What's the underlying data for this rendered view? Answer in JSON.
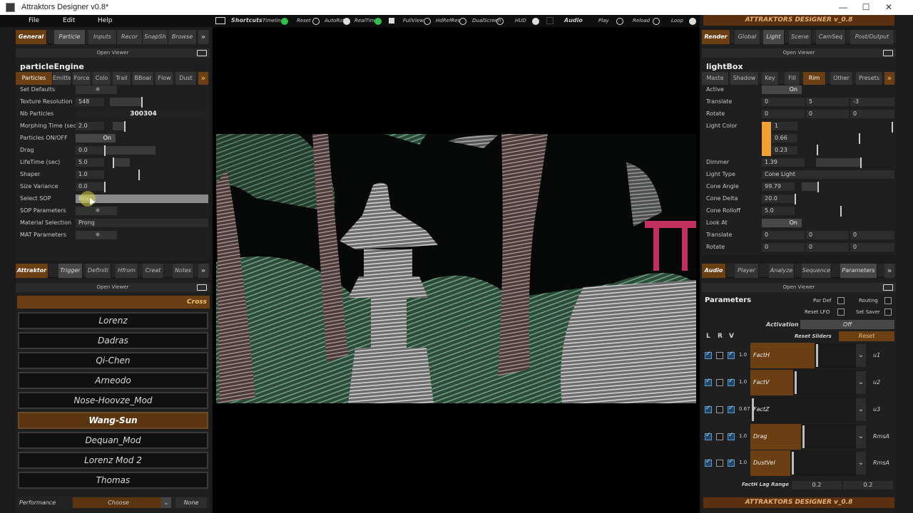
{
  "window": {
    "title": "Attraktors Designer v0.8*"
  },
  "menu": {
    "file": "File",
    "edit": "Edit",
    "help": "Help"
  },
  "toolbar": {
    "shortcuts": "Shortcuts",
    "timeline": "Timeline",
    "reset": "Reset",
    "autorot": "AutoRot",
    "realtime": "RealTime",
    "fullview": "FullView",
    "hdrefres": "HdRefRes",
    "dualscreen": "DualScreen",
    "hud": "HUD",
    "audio": "Audio",
    "play": "Play",
    "reload": "Reload",
    "loop": "Loop"
  },
  "left_top": {
    "tabs": [
      "General",
      "Particle",
      "Inputs",
      "Recor",
      "SnapSh",
      "Browse"
    ],
    "open_viewer": "Open Viewer",
    "title": "particleEngine",
    "subtabs": [
      "Particles",
      "Emitte",
      "Force",
      "Colo",
      "Trail",
      "BBoar",
      "Flow",
      "Dust"
    ],
    "params": [
      {
        "label": "Set Defaults",
        "value": ""
      },
      {
        "label": "Texture Resolution",
        "value": "548"
      },
      {
        "label": "Nb Particles",
        "value": "300304"
      },
      {
        "label": "Morphing Time (sec)",
        "value": "2.0"
      },
      {
        "label": "Particles ON/OFF",
        "value": "On"
      },
      {
        "label": "Drag",
        "value": "0.0"
      },
      {
        "label": "LifeTime (sec)",
        "value": "5.0"
      },
      {
        "label": "Shaper",
        "value": "1.0"
      },
      {
        "label": "Size Variance",
        "value": "0.0"
      },
      {
        "label": "Select SOP",
        "value": "Box"
      },
      {
        "label": "SOP Parameters",
        "value": ""
      },
      {
        "label": "Material Selection",
        "value": "Prong"
      },
      {
        "label": "MAT Parameters",
        "value": ""
      }
    ]
  },
  "left_bottom": {
    "tabs": [
      "Attraktor",
      "Trigger",
      "Definiti",
      "Hfrom",
      "Creat",
      "Notes"
    ],
    "open_viewer": "Open Viewer",
    "header": "Cross",
    "attractors": [
      "Lorenz",
      "Dadras",
      "Qi-Chen",
      "Arneodo",
      "Nose-Hoovze_Mod",
      "Wang-Sun",
      "Dequan_Mod",
      "Lorenz Mod 2",
      "Thomas"
    ],
    "selected": "Wang-Sun",
    "performance_label": "Performance",
    "choose": "Choose",
    "none": "None"
  },
  "right_top": {
    "header": "ATTRAKTORS DESIGNER v_0.8",
    "tabs": [
      "Render",
      "Global",
      "Light",
      "Scene",
      "CamSeq",
      "Post/Output"
    ],
    "open_viewer": "Open Viewer",
    "title": "lightBox",
    "subtabs": [
      "Maste",
      "Shadow",
      "Key",
      "Fill",
      "Rim",
      "Other",
      "Presets"
    ],
    "active_label": "Active",
    "active_value": "On",
    "translate_label": "Translate",
    "translate": [
      "0",
      "5",
      "-3"
    ],
    "rotate_label": "Rotate",
    "rotate": [
      "0",
      "0",
      "0"
    ],
    "light_color_label": "Light Color",
    "light_color": [
      "1",
      "0.66",
      "0.23"
    ],
    "light_color_hex": "#f0a030",
    "dimmer_label": "Dimmer",
    "dimmer": "1.39",
    "light_type_label": "Light Type",
    "light_type": "Cone Light",
    "cone_angle_label": "Cone Angle",
    "cone_angle": "99.79",
    "cone_delta_label": "Cone Delta",
    "cone_delta": "20.0",
    "cone_rolloff_label": "Cone Rolloff",
    "cone_rolloff": "5.0",
    "look_at_label": "Look At",
    "look_at": "On",
    "translate2": [
      "0",
      "0",
      "0"
    ],
    "rotate2": [
      "0",
      "0",
      "0"
    ]
  },
  "right_bottom": {
    "tabs": [
      "Audio",
      "Player",
      "Analyze",
      "Sequence",
      "Parameters"
    ],
    "open_viewer": "Open Viewer",
    "title": "Parameters",
    "par_def": "Par Def",
    "routing": "Routing",
    "reset_lfo": "Reset LFO",
    "set_saver": "Set Saver",
    "activation": "Activation",
    "activation_value": "Off",
    "lrv": [
      "L",
      "R",
      "V"
    ],
    "reset_sliders": "Reset Sliders",
    "reset": "Reset",
    "rows": [
      {
        "val": "1.0",
        "name": "FactH",
        "fill": 0.6,
        "src": "u1"
      },
      {
        "val": "1.0",
        "name": "FactV",
        "fill": 0.4,
        "src": "u2"
      },
      {
        "val": "0.67",
        "name": "FactZ",
        "fill": 0.0,
        "src": "u3"
      },
      {
        "val": "1.0",
        "name": "Drag",
        "fill": 0.47,
        "src": "RmsA"
      },
      {
        "val": "1.0",
        "name": "DustVel",
        "fill": 0.37,
        "src": "RmsA"
      }
    ],
    "lag_label": "FactH Lag Range",
    "lag_min": "0.2",
    "lag_max": "0.2",
    "footer": "ATTRAKTORS DESIGNER v_0.8"
  }
}
